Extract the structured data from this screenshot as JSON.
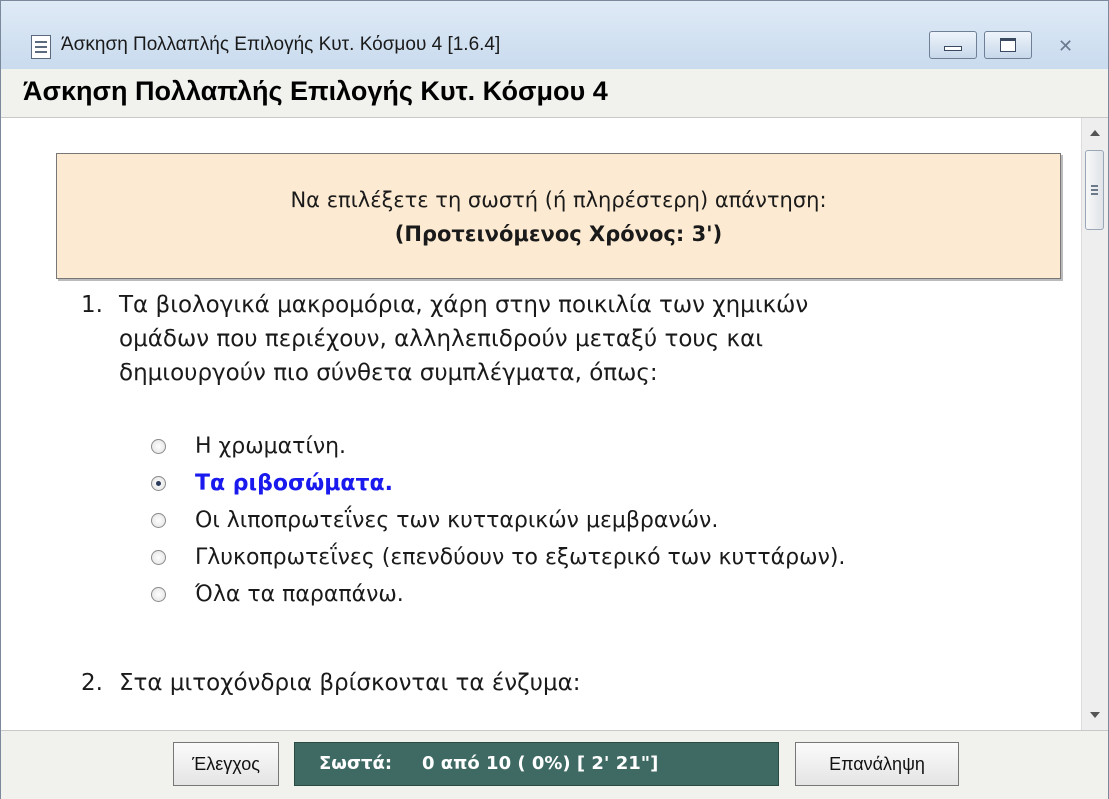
{
  "window": {
    "title": "Άσκηση Πολλαπλής Επιλογής Κυτ. Κόσμου 4   [1.6.4]",
    "icon": "document-icon",
    "controls": [
      "minimize-icon",
      "maximize-icon",
      "close-icon"
    ]
  },
  "page": {
    "title": "Άσκηση Πολλαπλής Επιλογής Κυτ. Κόσμου 4"
  },
  "instructions": {
    "line1": "Να επιλέξετε τη σωστή (ή πληρέστερη) απάντηση:",
    "line2": "(Προτεινόμενος Χρόνος: 3')"
  },
  "questions": [
    {
      "number": "1.",
      "lines": [
        "Τα βιολογικά μακρομόρια, χάρη στην ποικιλία των χημικών",
        "ομάδων που περιέχουν, αλληλεπιδρούν μεταξύ τους και",
        "δημιουργούν πιο σύνθετα συμπλέγματα, όπως:"
      ],
      "options": [
        {
          "label": "Η χρωματίνη.",
          "selected": false
        },
        {
          "label": "Τα ριβοσώματα.",
          "selected": true
        },
        {
          "label": "Οι λιποπρωτεΐνες των κυτταρικών μεμβρανών.",
          "selected": false
        },
        {
          "label": "Γλυκοπρωτεΐνες (επενδύουν το εξωτερικό των κυττάρων).",
          "selected": false
        },
        {
          "label": "Όλα τα παραπάνω.",
          "selected": false
        }
      ]
    },
    {
      "number": "2.",
      "lines": [
        "Στα μιτοχόνδρια βρίσκονται τα ένζυμα:"
      ]
    }
  ],
  "footer": {
    "check_label": "Έλεγχος",
    "score_label": "Σωστά:",
    "score_value": "0 από 10  (   0%)   [  2' 21\"]",
    "repeat_label": "Επανάληψη"
  },
  "colors": {
    "instruction_bg": "#fcebd2",
    "score_bg": "#3f6a64",
    "selected_option": "#1a1aee"
  }
}
